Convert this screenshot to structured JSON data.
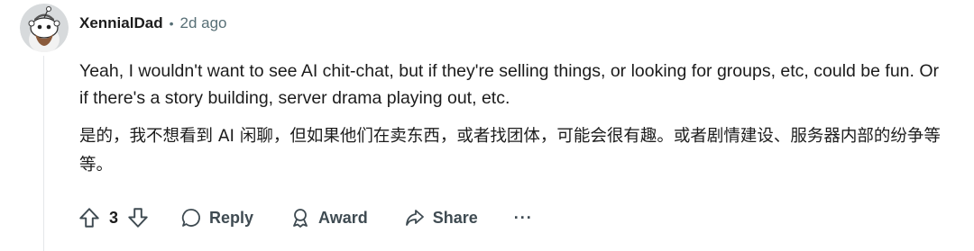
{
  "comment": {
    "username": "XennialDad",
    "separator": "•",
    "time": "2d ago",
    "text_en": "Yeah, I wouldn't want to see AI chit-chat, but if they're selling things, or looking for groups, etc, could be fun. Or if there's a story building, server drama playing out, etc.",
    "text_zh": "是的，我不想看到 AI 闲聊，但如果他们在卖东西，或者找团体，可能会很有趣。或者剧情建设、服务器内部的纷争等等。"
  },
  "actions": {
    "score": "3",
    "reply_label": "Reply",
    "award_label": "Award",
    "share_label": "Share",
    "more_label": "···"
  },
  "icons": {
    "avatar": "snoo-avatar-icon",
    "upvote": "upvote-arrow-icon",
    "downvote": "downvote-arrow-icon",
    "reply": "speech-bubble-icon",
    "award": "award-ribbon-icon",
    "share": "share-arrow-icon"
  }
}
